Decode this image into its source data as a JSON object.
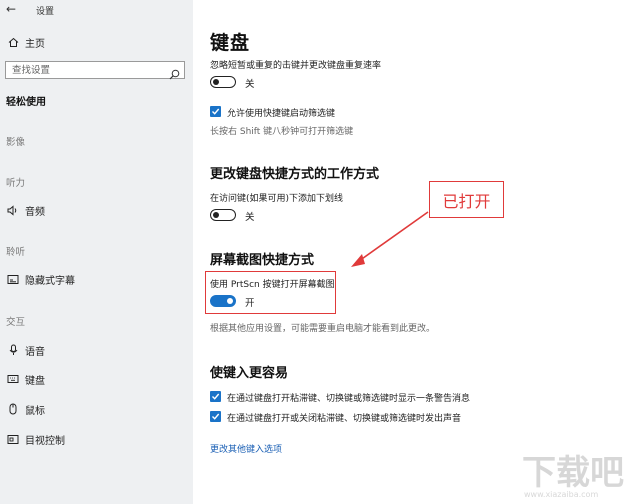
{
  "window": {
    "title": "设置"
  },
  "sidebar": {
    "home_label": "主页",
    "search_placeholder": "查找设置",
    "category_current": "轻松使用",
    "sections": [
      {
        "label": "影像"
      },
      {
        "label": "听力"
      },
      {
        "label": "聆听"
      },
      {
        "label": "交互"
      }
    ],
    "items": {
      "audio": "音频",
      "captions": "隐藏式字幕",
      "speech": "语音",
      "keyboard": "键盘",
      "mouse": "鼠标",
      "eye_control": "目视控制"
    }
  },
  "main": {
    "title": "键盘",
    "filter_desc": "忽略短暂或重复的击键并更改键盘重复速率",
    "filter_toggle_label": "关",
    "filter_checkbox_label": "允许使用快捷键启动筛选键",
    "filter_hint": "长按右 Shift 键八秒钟可打开筛选键",
    "shortcut_heading": "更改键盘快捷方式的工作方式",
    "underline_desc": "在访问键(如果可用)下添加下划线",
    "underline_toggle_label": "关",
    "screenshot_heading": "屏幕截图快捷方式",
    "prtscn_desc": "使用 PrtScn 按键打开屏幕截图",
    "prtscn_toggle_label": "开",
    "restart_hint": "根据其他应用设置，可能需要重启电脑才能看到此更改。",
    "typing_heading": "使键入更容易",
    "check1_label": "在通过键盘打开粘滞键、切换键或筛选键时显示一条警告消息",
    "check2_label": "在通过键盘打开或关闭粘滞键、切换键或筛选键时发出声音",
    "more_link": "更改其他键入选项"
  },
  "annotation": {
    "callout_text": "已打开"
  },
  "watermark": {
    "text": "下载吧",
    "url": "www.xiazaiba.com"
  },
  "colors": {
    "accent": "#1a73c8",
    "annotation_red": "#e03a3a",
    "sidebar_bg": "#eef0f2"
  }
}
